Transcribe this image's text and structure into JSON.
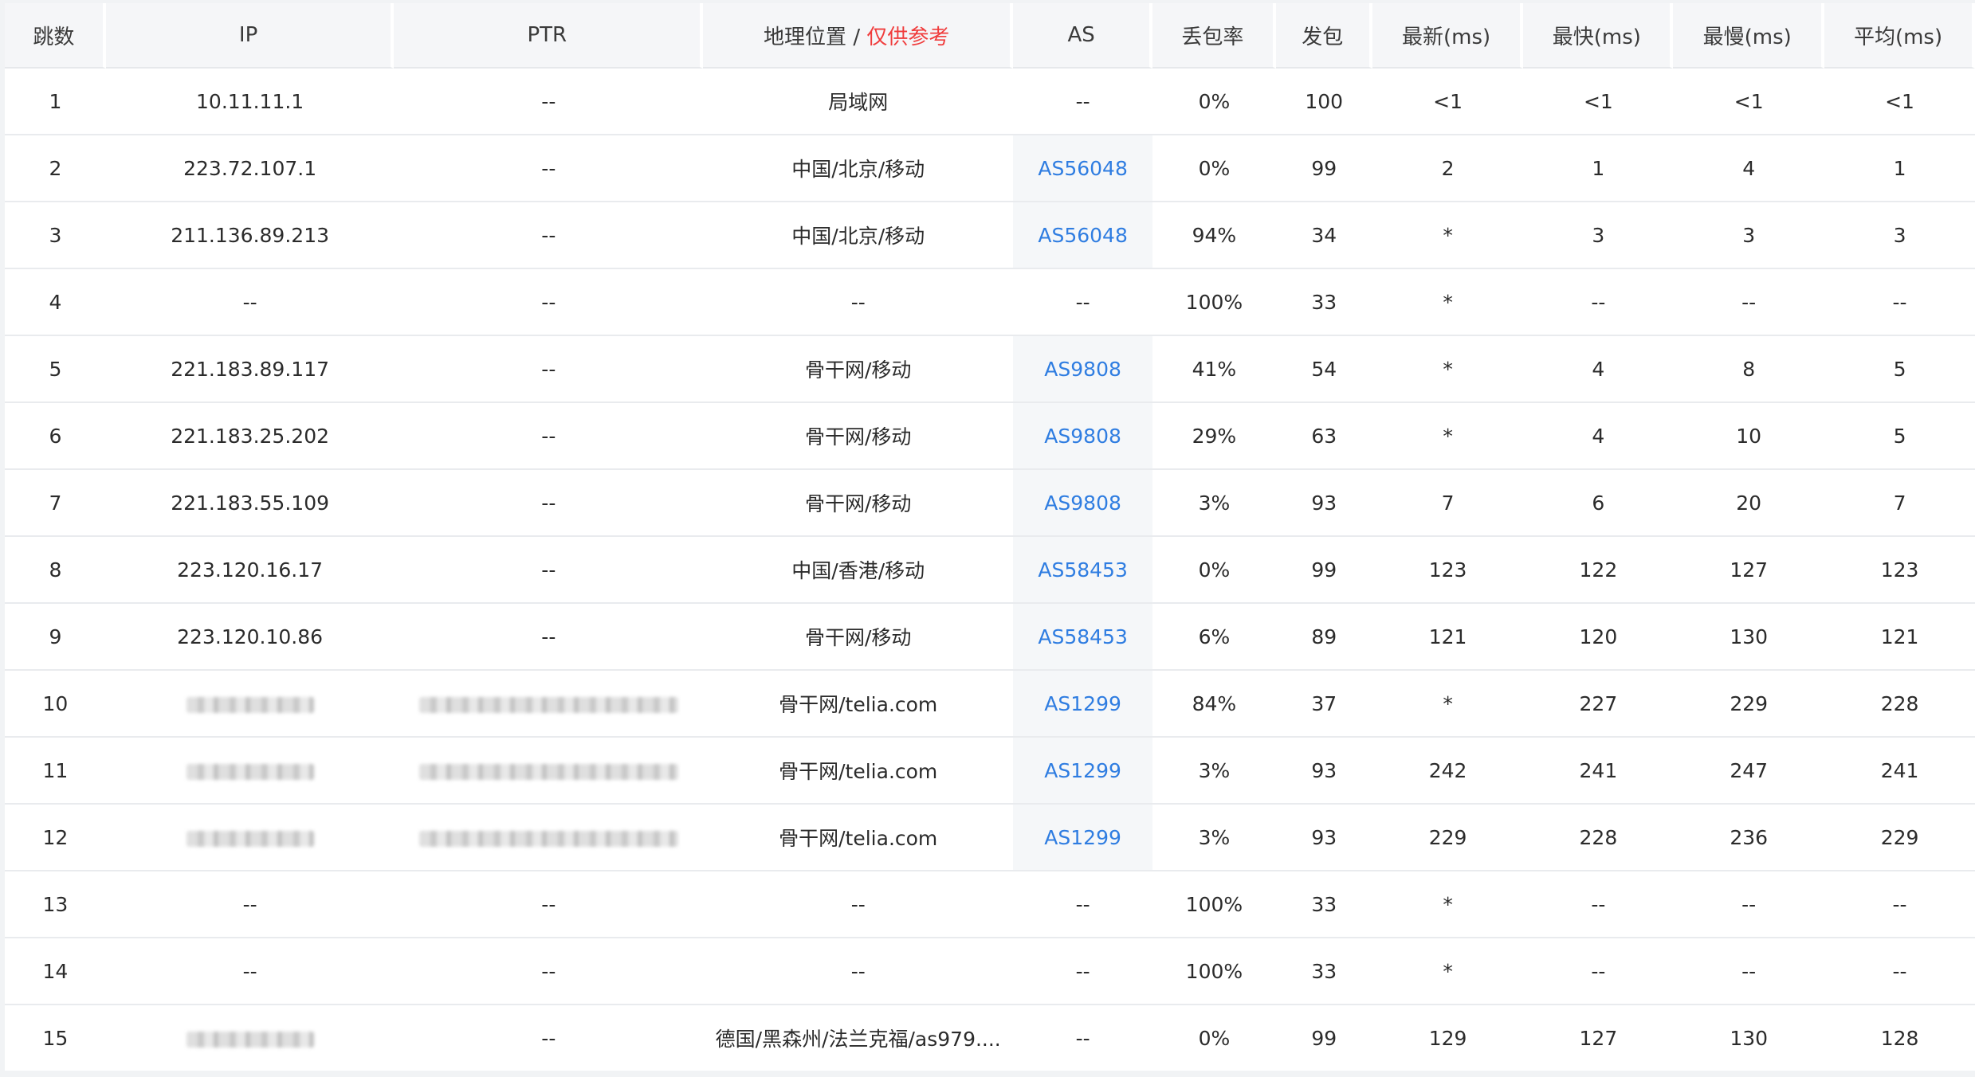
{
  "header": {
    "hop": "跳数",
    "ip": "IP",
    "ptr": "PTR",
    "geo": "地理位置",
    "geo_sep": " / ",
    "geo_note": "仅供参考",
    "as": "AS",
    "loss": "丢包率",
    "sent": "发包",
    "last": "最新(ms)",
    "best": "最快(ms)",
    "worst": "最慢(ms)",
    "avg": "平均(ms)"
  },
  "colors": {
    "as_link": "#2f7de1",
    "warning": "#f03c3c",
    "header_bg": "#f5f6f8"
  },
  "rows": [
    {
      "hop": "1",
      "ip": "10.11.11.1",
      "ip_masked": false,
      "ptr": "--",
      "ptr_masked": false,
      "geo": "局域网",
      "as": "--",
      "as_link": false,
      "loss": "0%",
      "sent": "100",
      "last": "<1",
      "best": "<1",
      "worst": "<1",
      "avg": "<1"
    },
    {
      "hop": "2",
      "ip": "223.72.107.1",
      "ip_masked": false,
      "ptr": "--",
      "ptr_masked": false,
      "geo": "中国/北京/移动",
      "as": "AS56048",
      "as_link": true,
      "loss": "0%",
      "sent": "99",
      "last": "2",
      "best": "1",
      "worst": "4",
      "avg": "1"
    },
    {
      "hop": "3",
      "ip": "211.136.89.213",
      "ip_masked": false,
      "ptr": "--",
      "ptr_masked": false,
      "geo": "中国/北京/移动",
      "as": "AS56048",
      "as_link": true,
      "loss": "94%",
      "sent": "34",
      "last": "*",
      "best": "3",
      "worst": "3",
      "avg": "3"
    },
    {
      "hop": "4",
      "ip": "--",
      "ip_masked": false,
      "ptr": "--",
      "ptr_masked": false,
      "geo": "--",
      "as": "--",
      "as_link": false,
      "loss": "100%",
      "sent": "33",
      "last": "*",
      "best": "--",
      "worst": "--",
      "avg": "--"
    },
    {
      "hop": "5",
      "ip": "221.183.89.117",
      "ip_masked": false,
      "ptr": "--",
      "ptr_masked": false,
      "geo": "骨干网/移动",
      "as": "AS9808",
      "as_link": true,
      "loss": "41%",
      "sent": "54",
      "last": "*",
      "best": "4",
      "worst": "8",
      "avg": "5"
    },
    {
      "hop": "6",
      "ip": "221.183.25.202",
      "ip_masked": false,
      "ptr": "--",
      "ptr_masked": false,
      "geo": "骨干网/移动",
      "as": "AS9808",
      "as_link": true,
      "loss": "29%",
      "sent": "63",
      "last": "*",
      "best": "4",
      "worst": "10",
      "avg": "5"
    },
    {
      "hop": "7",
      "ip": "221.183.55.109",
      "ip_masked": false,
      "ptr": "--",
      "ptr_masked": false,
      "geo": "骨干网/移动",
      "as": "AS9808",
      "as_link": true,
      "loss": "3%",
      "sent": "93",
      "last": "7",
      "best": "6",
      "worst": "20",
      "avg": "7"
    },
    {
      "hop": "8",
      "ip": "223.120.16.17",
      "ip_masked": false,
      "ptr": "--",
      "ptr_masked": false,
      "geo": "中国/香港/移动",
      "as": "AS58453",
      "as_link": true,
      "loss": "0%",
      "sent": "99",
      "last": "123",
      "best": "122",
      "worst": "127",
      "avg": "123"
    },
    {
      "hop": "9",
      "ip": "223.120.10.86",
      "ip_masked": false,
      "ptr": "--",
      "ptr_masked": false,
      "geo": "骨干网/移动",
      "as": "AS58453",
      "as_link": true,
      "loss": "6%",
      "sent": "89",
      "last": "121",
      "best": "120",
      "worst": "130",
      "avg": "121"
    },
    {
      "hop": "10",
      "ip": "",
      "ip_masked": true,
      "ptr": "",
      "ptr_masked": true,
      "geo": "骨干网/telia.com",
      "as": "AS1299",
      "as_link": true,
      "loss": "84%",
      "sent": "37",
      "last": "*",
      "best": "227",
      "worst": "229",
      "avg": "228"
    },
    {
      "hop": "11",
      "ip": "",
      "ip_masked": true,
      "ptr": "",
      "ptr_masked": true,
      "geo": "骨干网/telia.com",
      "as": "AS1299",
      "as_link": true,
      "loss": "3%",
      "sent": "93",
      "last": "242",
      "best": "241",
      "worst": "247",
      "avg": "241"
    },
    {
      "hop": "12",
      "ip": "",
      "ip_masked": true,
      "ptr": "",
      "ptr_masked": true,
      "geo": "骨干网/telia.com",
      "as": "AS1299",
      "as_link": true,
      "loss": "3%",
      "sent": "93",
      "last": "229",
      "best": "228",
      "worst": "236",
      "avg": "229"
    },
    {
      "hop": "13",
      "ip": "--",
      "ip_masked": false,
      "ptr": "--",
      "ptr_masked": false,
      "geo": "--",
      "as": "--",
      "as_link": false,
      "loss": "100%",
      "sent": "33",
      "last": "*",
      "best": "--",
      "worst": "--",
      "avg": "--"
    },
    {
      "hop": "14",
      "ip": "--",
      "ip_masked": false,
      "ptr": "--",
      "ptr_masked": false,
      "geo": "--",
      "as": "--",
      "as_link": false,
      "loss": "100%",
      "sent": "33",
      "last": "*",
      "best": "--",
      "worst": "--",
      "avg": "--"
    },
    {
      "hop": "15",
      "ip": "",
      "ip_masked": true,
      "ptr": "--",
      "ptr_masked": false,
      "geo": "德国/黑森州/法兰克福/as979....",
      "as": "--",
      "as_link": false,
      "loss": "0%",
      "sent": "99",
      "last": "129",
      "best": "127",
      "worst": "130",
      "avg": "128"
    }
  ]
}
